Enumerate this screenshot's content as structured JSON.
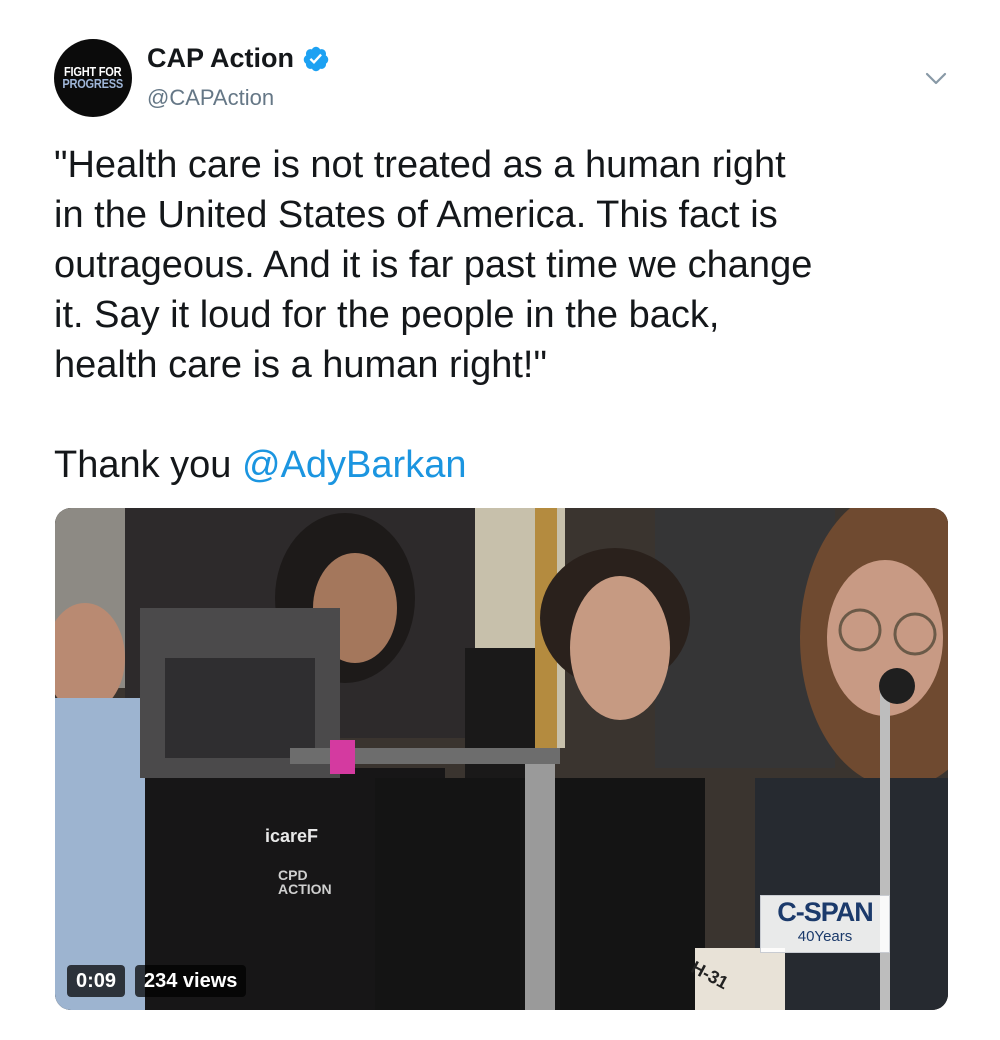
{
  "author": {
    "avatar_line1": "FIGHT FOR",
    "avatar_line2": "PROGRESS",
    "display_name": "CAP Action",
    "handle": "@CAPAction",
    "verified": true
  },
  "tweet": {
    "text": "\"Health care is not treated as a human right\nin the United States of America. This fact is\noutrageous. And it is far past time we change\nit. Say it loud for the people in the back,\nhealth care is a human right!\"",
    "thanks_prefix": "Thank you ",
    "mention": "@AdyBarkan"
  },
  "video": {
    "duration": "0:09",
    "views": "234 views",
    "network_logo": "C-SPAN",
    "network_sub": "40Years",
    "shirt_text": "icareF",
    "tag_text_1": "CPD",
    "tag_text_2": "ACTION",
    "placard_text": "H-31"
  },
  "icons": {
    "verified": "verified-badge-icon",
    "menu": "chevron-down-icon"
  },
  "colors": {
    "link": "#1b95e0",
    "verified": "#1da1f2",
    "secondary_text": "#657786"
  }
}
